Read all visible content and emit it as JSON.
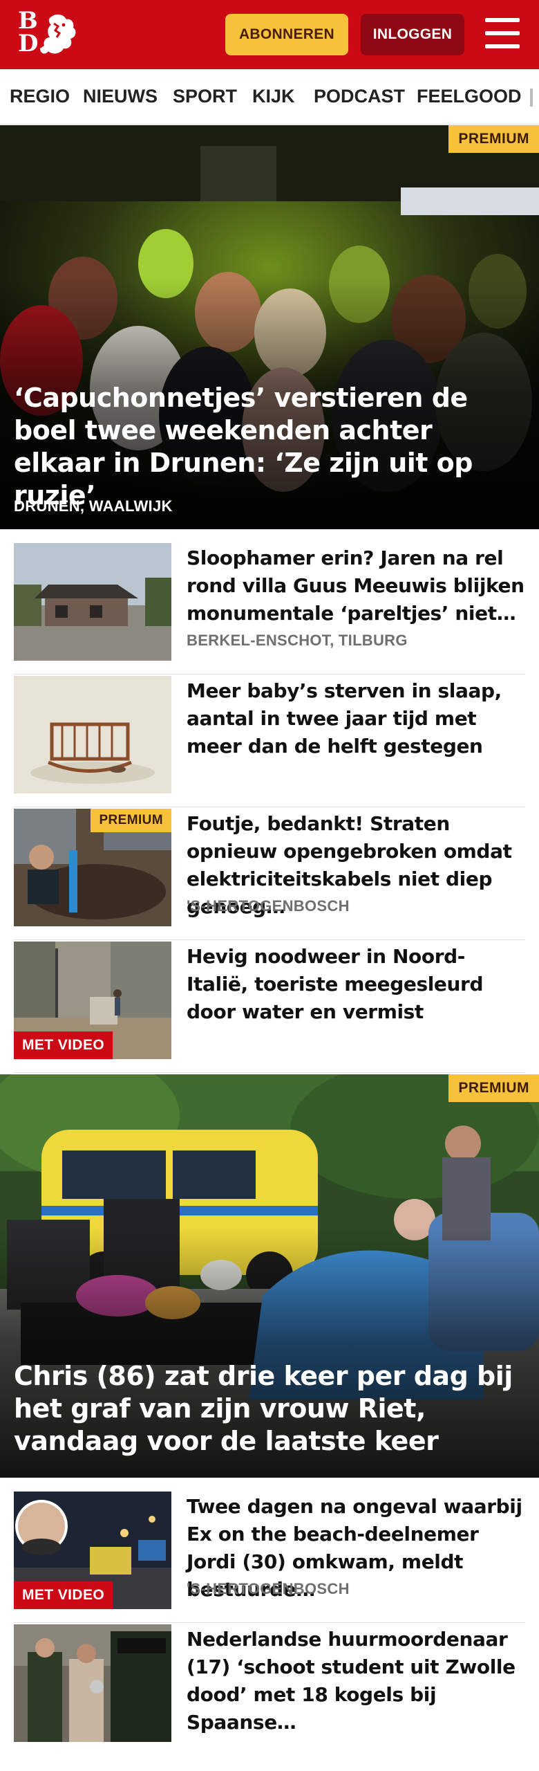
{
  "brand": {
    "logo_text": "BD",
    "accent_color": "#cc0a16",
    "subscribe_color": "#f7c23b"
  },
  "header": {
    "subscribe_label": "ABONNEREN",
    "login_label": "INLOGGEN",
    "menu_icon": "hamburger-menu-icon"
  },
  "nav": {
    "items": [
      "REGIO",
      "NIEUWS",
      "SPORT",
      "KIJK",
      "PODCAST",
      "FEELGOOD"
    ]
  },
  "hero1": {
    "badge": "PREMIUM",
    "title": "‘Capuchonnetjes’ verstieren de boel twee weekenden achter elkaar in Drunen: ‘Ze zijn uit op ruzie’",
    "location": "DRUNEN, WAALWIJK"
  },
  "articles1": [
    {
      "title": "Sloophamer erin? Jaren na rel rond villa Guus Meeuwis blijken monumentale ‘pareltjes’ niet…",
      "location": "BERKEL-ENSCHOT, TILBURG"
    },
    {
      "title": "Meer baby’s sterven in slaap, aantal in twee jaar tijd met meer dan de helft gestegen"
    },
    {
      "badge": "PREMIUM",
      "title": "Foutje, bedankt! Straten opnieuw opengebroken omdat elektrici­teitskabels niet diep genoeg…",
      "location": "'S-HERTOGENBOSCH"
    },
    {
      "badge": "MET VIDEO",
      "title": "Hevig noodweer in Noord-Italië, toeriste meegesleurd door water en vermist"
    }
  ],
  "hero2": {
    "badge": "PREMIUM",
    "title": "Chris (86) zat drie keer per dag bij het graf van zijn vrouw Riet, vandaag voor de laatste keer"
  },
  "articles2": [
    {
      "badge": "MET VIDEO",
      "title": "Twee dagen na ongeval waarbij Ex on the beach-deelnemer Jordi (30) omkwam, meldt bestuurde…",
      "location": "'S-HERTOGENBOSCH"
    },
    {
      "title": "Nederlandse huurmoordenaar (17) ‘schoot student uit Zwolle dood’ met 18 kogels bij Spaanse…"
    }
  ]
}
